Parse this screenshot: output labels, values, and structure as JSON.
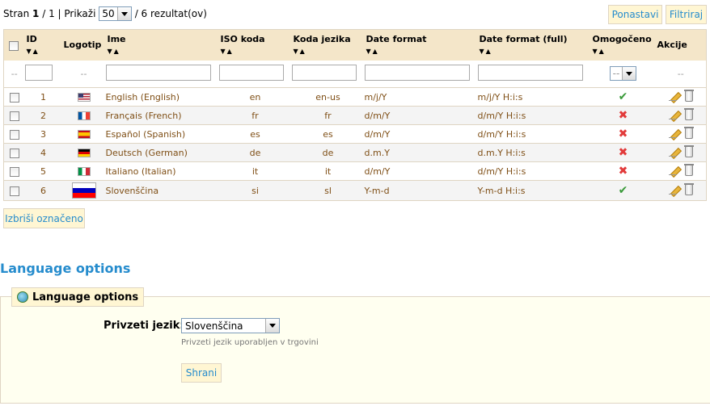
{
  "pagination": {
    "prefix": "Stran",
    "current": "1",
    "sep": "/ 1 | Prikaži",
    "per_page": "50",
    "results": "/ 6 rezultat(ov)"
  },
  "toolbar": {
    "reset_label": "Ponastavi",
    "filter_label": "Filtriraj"
  },
  "table": {
    "headers": {
      "id": "ID",
      "logo": "Logotip",
      "name": "Ime",
      "iso": "ISO koda",
      "lang_code": "Koda jezika",
      "date_format": "Date format",
      "date_full": "Date format (full)",
      "enabled": "Omogočeno",
      "actions": "Akcije"
    },
    "filter": {
      "placeholder_dash": "--",
      "enabled_select": "--"
    },
    "rows": [
      {
        "id": "1",
        "flag": "us",
        "name": "English (English)",
        "iso": "en",
        "code": "en-us",
        "date": "m/j/Y",
        "date_full": "m/j/Y H:i:s",
        "enabled": true
      },
      {
        "id": "2",
        "flag": "fr",
        "name": "Français (French)",
        "iso": "fr",
        "code": "fr",
        "date": "d/m/Y",
        "date_full": "d/m/Y H:i:s",
        "enabled": false
      },
      {
        "id": "3",
        "flag": "es",
        "name": "Español (Spanish)",
        "iso": "es",
        "code": "es",
        "date": "d/m/Y",
        "date_full": "d/m/Y H:i:s",
        "enabled": false
      },
      {
        "id": "4",
        "flag": "de",
        "name": "Deutsch (German)",
        "iso": "de",
        "code": "de",
        "date": "d.m.Y",
        "date_full": "d.m.Y H:i:s",
        "enabled": false
      },
      {
        "id": "5",
        "flag": "it",
        "name": "Italiano (Italian)",
        "iso": "it",
        "code": "it",
        "date": "d/m/Y",
        "date_full": "d/m/Y H:i:s",
        "enabled": false
      },
      {
        "id": "6",
        "flag": "si",
        "name": "Slovenščina",
        "iso": "si",
        "code": "sl",
        "date": "Y-m-d",
        "date_full": "Y-m-d H:i:s",
        "enabled": true
      }
    ]
  },
  "bulk": {
    "delete_label": "Izbriši označeno"
  },
  "options": {
    "section_title": "Language options",
    "legend": "Language options",
    "default_label": "Privzeti jezik:",
    "default_value": "Slovenščina",
    "hint": "Privzeti jezik uporabljen v trgovini",
    "save_label": "Shrani"
  },
  "colors": {
    "accent": "#268ccd",
    "header_bg": "#f4e6c9",
    "button_bg": "#fff6d3"
  }
}
